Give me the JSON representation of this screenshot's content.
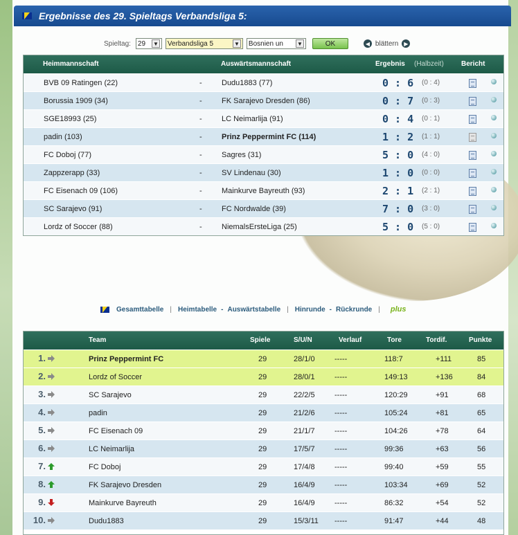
{
  "header": {
    "title": "Ergebnisse des 29. Spieltags Verbandsliga 5:"
  },
  "controls": {
    "spieltag_label": "Spieltag:",
    "spieltag_value": "29",
    "liga_value": "Verbandsliga 5",
    "land_value": "Bosnien un",
    "ok_label": "OK",
    "blaettern_label": "blättern"
  },
  "results": {
    "headers": {
      "home": "Heimmannschaft",
      "away": "Auswärtsmannschaft",
      "result": "Ergebnis",
      "half": "(Halbzeit)",
      "report": "Bericht"
    },
    "rows": [
      {
        "home": "BVB 09 Ratingen (22)",
        "sep": "-",
        "away": "Dudu1883 (77)",
        "score": "0 : 6",
        "half": "(0 : 4)"
      },
      {
        "home": "Borussia 1909 (34)",
        "sep": "-",
        "away": "FK Sarajevo Dresden (86)",
        "score": "0 : 7",
        "half": "(0 : 3)"
      },
      {
        "home": "SGE18993 (25)",
        "sep": "-",
        "away": "LC Neimarlija (91)",
        "score": "0 : 4",
        "half": "(0 : 1)"
      },
      {
        "home": "padin (103)",
        "sep": "-",
        "away": "Prinz Peppermint FC (114)",
        "score": "1 : 2",
        "half": "(1 : 1)"
      },
      {
        "home": "FC Doboj (77)",
        "sep": "-",
        "away": "Sagres (31)",
        "score": "5 : 0",
        "half": "(4 : 0)"
      },
      {
        "home": "Zappzerapp (33)",
        "sep": "-",
        "away": "SV Lindenau (30)",
        "score": "1 : 0",
        "half": "(0 : 0)"
      },
      {
        "home": "FC Eisenach 09 (106)",
        "sep": "-",
        "away": "Mainkurve Bayreuth (93)",
        "score": "2 : 1",
        "half": "(2 : 1)"
      },
      {
        "home": "SC Sarajevo (91)",
        "sep": "-",
        "away": "FC Nordwalde (39)",
        "score": "7 : 0",
        "half": "(3 : 0)"
      },
      {
        "home": "Lordz of Soccer (88)",
        "sep": "-",
        "away": "NiemalsErsteLiga (25)",
        "score": "5 : 0",
        "half": "(5 : 0)"
      }
    ]
  },
  "links": {
    "gesamt": "Gesamttabelle",
    "heim": "Heimtabelle",
    "dash": "-",
    "auswaerts": "Auswärtstabelle",
    "hinrunde": "Hinrunde",
    "rueckrunde": "Rückrunde",
    "plus": "plus",
    "pipe": "|"
  },
  "standings": {
    "headers": {
      "team": "Team",
      "spiele": "Spiele",
      "sun": "S/U/N",
      "verlauf": "Verlauf",
      "tore": "Tore",
      "tordif": "Tordif.",
      "punkte": "Punkte"
    },
    "rows": [
      {
        "rank": "1.",
        "trend": "same",
        "team": "Prinz Peppermint FC",
        "spiele": "29",
        "sun": "28/1/0",
        "verlauf": "-----",
        "tore": "118:7",
        "tordif": "+111",
        "punkte": "85"
      },
      {
        "rank": "2.",
        "trend": "same",
        "team": "Lordz of Soccer",
        "spiele": "29",
        "sun": "28/0/1",
        "verlauf": "-----",
        "tore": "149:13",
        "tordif": "+136",
        "punkte": "84"
      },
      {
        "rank": "3.",
        "trend": "same",
        "team": "SC Sarajevo",
        "spiele": "29",
        "sun": "22/2/5",
        "verlauf": "-----",
        "tore": "120:29",
        "tordif": "+91",
        "punkte": "68"
      },
      {
        "rank": "4.",
        "trend": "same",
        "team": "padin",
        "spiele": "29",
        "sun": "21/2/6",
        "verlauf": "-----",
        "tore": "105:24",
        "tordif": "+81",
        "punkte": "65"
      },
      {
        "rank": "5.",
        "trend": "same",
        "team": "FC Eisenach 09",
        "spiele": "29",
        "sun": "21/1/7",
        "verlauf": "-----",
        "tore": "104:26",
        "tordif": "+78",
        "punkte": "64"
      },
      {
        "rank": "6.",
        "trend": "same",
        "team": "LC Neimarlija",
        "spiele": "29",
        "sun": "17/5/7",
        "verlauf": "-----",
        "tore": "99:36",
        "tordif": "+63",
        "punkte": "56"
      },
      {
        "rank": "7.",
        "trend": "up",
        "team": "FC Doboj",
        "spiele": "29",
        "sun": "17/4/8",
        "verlauf": "-----",
        "tore": "99:40",
        "tordif": "+59",
        "punkte": "55"
      },
      {
        "rank": "8.",
        "trend": "up",
        "team": "FK Sarajevo Dresden",
        "spiele": "29",
        "sun": "16/4/9",
        "verlauf": "-----",
        "tore": "103:34",
        "tordif": "+69",
        "punkte": "52"
      },
      {
        "rank": "9.",
        "trend": "down",
        "team": "Mainkurve Bayreuth",
        "spiele": "29",
        "sun": "16/4/9",
        "verlauf": "-----",
        "tore": "86:32",
        "tordif": "+54",
        "punkte": "52"
      },
      {
        "rank": "10.",
        "trend": "same",
        "team": "Dudu1883",
        "spiele": "29",
        "sun": "15/3/11",
        "verlauf": "-----",
        "tore": "91:47",
        "tordif": "+44",
        "punkte": "48"
      }
    ]
  }
}
